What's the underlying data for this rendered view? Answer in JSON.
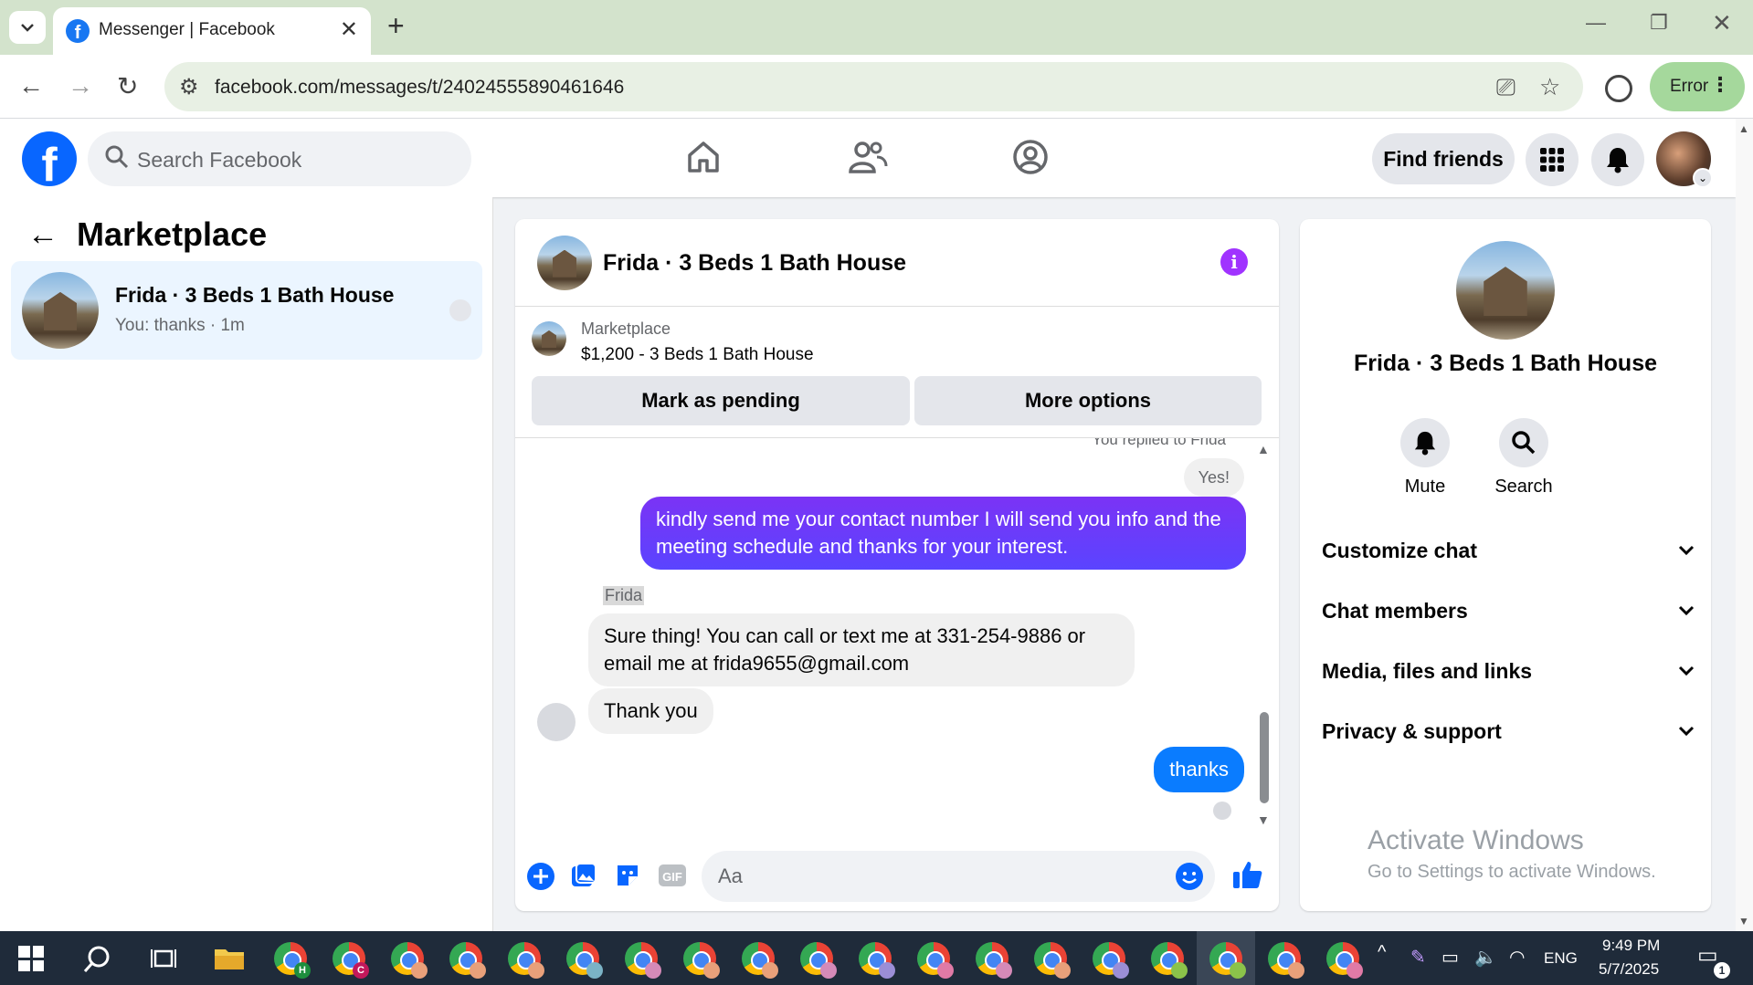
{
  "browser": {
    "tab_title": "Messenger | Facebook",
    "url": "facebook.com/messages/t/24024555890461646",
    "profile_status": "Error"
  },
  "fb_header": {
    "search_placeholder": "Search Facebook",
    "find_friends": "Find friends"
  },
  "left_panel": {
    "title": "Marketplace",
    "conversation": {
      "name": "Frida · 3 Beds 1 Bath House",
      "preview": "You: thanks · 1m"
    }
  },
  "chat": {
    "title": "Frida · 3 Beds 1 Bath House",
    "listing": {
      "label": "Marketplace",
      "title": "$1,200 - 3 Beds 1 Bath House"
    },
    "buttons": {
      "pending": "Mark as pending",
      "more": "More options"
    },
    "reply_note": "You replied to Frida",
    "messages": {
      "yes": "Yes!",
      "out1": "kindly send me your contact number I will send you info and the meeting schedule and thanks for your interest.",
      "sender": "Frida",
      "in1": "Sure thing! You can call or text me at 331-254-9886 or email me at frida9655@gmail.com",
      "in2": "Thank you",
      "out2": "thanks"
    },
    "composer_placeholder": "Aa"
  },
  "info_panel": {
    "name": "Frida · 3 Beds 1 Bath House",
    "actions": {
      "mute": "Mute",
      "search": "Search"
    },
    "sections": {
      "customize": "Customize chat",
      "members": "Chat members",
      "media": "Media, files and links",
      "privacy": "Privacy & support"
    },
    "watermark": {
      "line1": "Activate Windows",
      "line2": "Go to Settings to activate Windows."
    }
  },
  "taskbar": {
    "lang": "ENG",
    "time": "9:49 PM",
    "date": "5/7/2025",
    "notifications": "1"
  },
  "colors": {
    "fb_blue": "#0866ff",
    "outgoing_bubble": "#5a44ff",
    "thanks_bubble": "#0a7cff",
    "info_purple": "#a033ff"
  }
}
